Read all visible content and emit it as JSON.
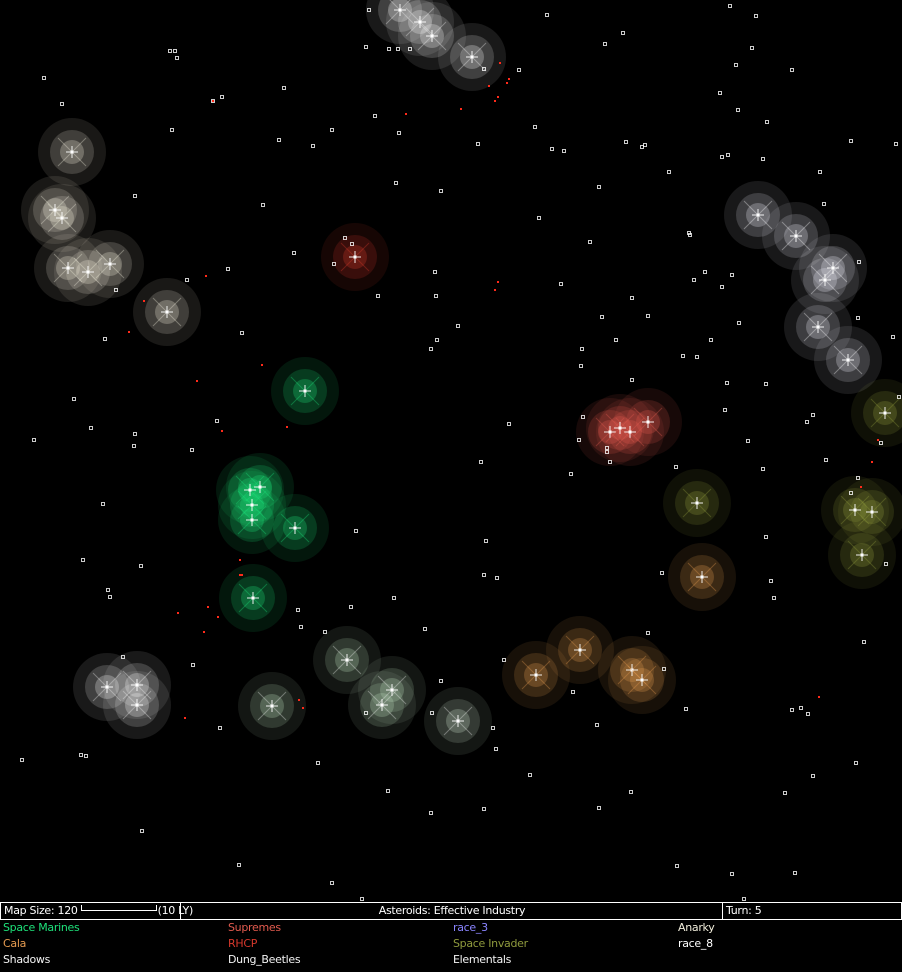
{
  "status_bar": {
    "map_size": "Map Size: 120",
    "scale_label": "(10 LY)",
    "special": "Asteroids: Effective Industry",
    "turn": "Turn: 5"
  },
  "races": [
    {
      "name": "Space Marines",
      "color": "#1de27a"
    },
    {
      "name": "Supremes",
      "color": "#e35b4f"
    },
    {
      "name": "race_3",
      "color": "#8a84ff"
    },
    {
      "name": "Anarky",
      "color": "#f2eedc"
    },
    {
      "name": "Cala",
      "color": "#e49a50"
    },
    {
      "name": "RHCP",
      "color": "#d6382c"
    },
    {
      "name": "Space Invader",
      "color": "#8f9a3d"
    },
    {
      "name": "race_8",
      "color": "#ffffff"
    },
    {
      "name": "Shadows",
      "color": "#f4f4f4"
    },
    {
      "name": "Dung_Beetles",
      "color": "#f4f4f4"
    },
    {
      "name": "Elementals",
      "color": "#f4f4f4"
    }
  ],
  "map": {
    "background": "#000000",
    "neutral_star_color": "#ffffff",
    "fleet_color": "#ff2a1a"
  }
}
